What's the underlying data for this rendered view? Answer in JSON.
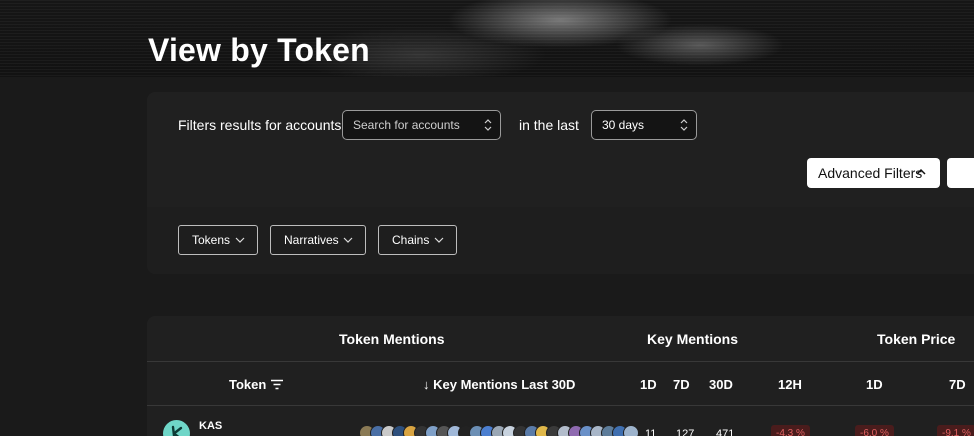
{
  "page": {
    "title": "View by Token"
  },
  "filters": {
    "accounts_label": "Filters results for accounts",
    "accounts_placeholder": "Search for accounts",
    "in_the_last_label": "in the last",
    "period_value": "30 days",
    "advanced_filters_label": "Advanced Filters",
    "chips": [
      {
        "label": "Tokens"
      },
      {
        "label": "Narratives"
      },
      {
        "label": "Chains"
      }
    ]
  },
  "table": {
    "group_headers": {
      "token_mentions": "Token Mentions",
      "key_mentions": "Key Mentions",
      "token_price": "Token Price"
    },
    "columns": {
      "token": "Token",
      "key_mentions_last_30d": "↓ Key Mentions Last 30D",
      "km_1d": "1D",
      "km_7d": "7D",
      "km_30d": "30D",
      "tp_12h": "12H",
      "tp_1d": "1D",
      "tp_7d": "7D"
    },
    "rows": [
      {
        "token": "KAS",
        "km_1d": "11",
        "km_7d": "127",
        "km_30d": "471",
        "tp_12h": "-4.3 %",
        "tp_1d": "-6.0 %",
        "tp_7d": "-9.1 %"
      }
    ]
  },
  "colors": {
    "background": "#1a1a1a",
    "card": "#202020",
    "negative": "#e06060",
    "token_avatar": "#6fd6c8"
  }
}
